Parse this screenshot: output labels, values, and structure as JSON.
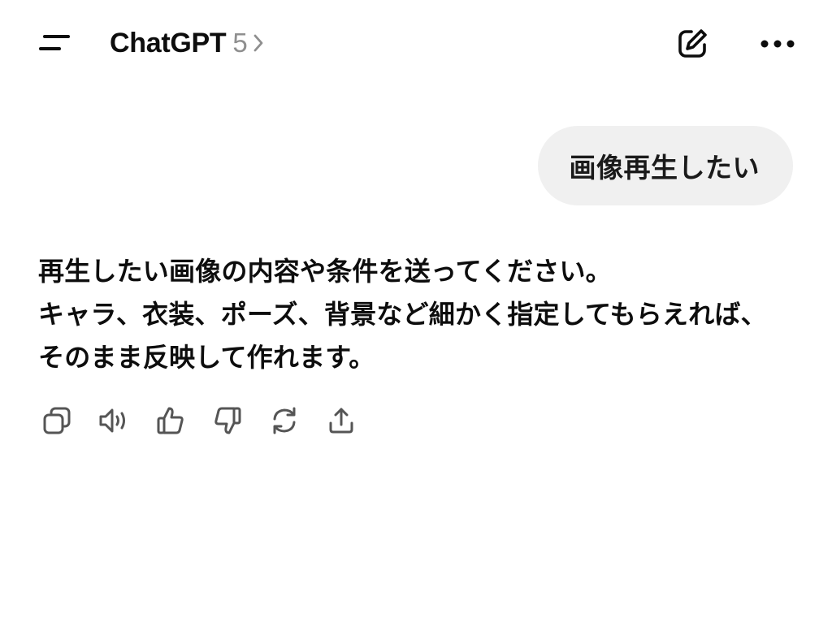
{
  "header": {
    "title": "ChatGPT",
    "model_version": "5",
    "menu_icon": "sidebar-menu-icon",
    "new_chat_icon": "edit-icon",
    "more_icon": "more-horizontal-icon"
  },
  "conversation": {
    "user_message": "画像再生したい",
    "assistant_message": {
      "lines": [
        "再生したい画像の内容や条件を送ってください。",
        "キャラ、衣装、ポーズ、背景など細かく指定してもらえれば、",
        "そのまま反映して作れます。"
      ]
    },
    "actions": [
      {
        "name": "copy",
        "icon": "copy-icon"
      },
      {
        "name": "read-aloud",
        "icon": "speaker-icon"
      },
      {
        "name": "good-response",
        "icon": "thumbs-up-icon"
      },
      {
        "name": "bad-response",
        "icon": "thumbs-down-icon"
      },
      {
        "name": "regenerate",
        "icon": "refresh-icon"
      },
      {
        "name": "share",
        "icon": "share-icon"
      }
    ]
  },
  "colors": {
    "text": "#0d0d0d",
    "muted": "#8f8f8f",
    "bubble_bg": "#f0f0f0",
    "background": "#ffffff",
    "icon": "#555555"
  }
}
